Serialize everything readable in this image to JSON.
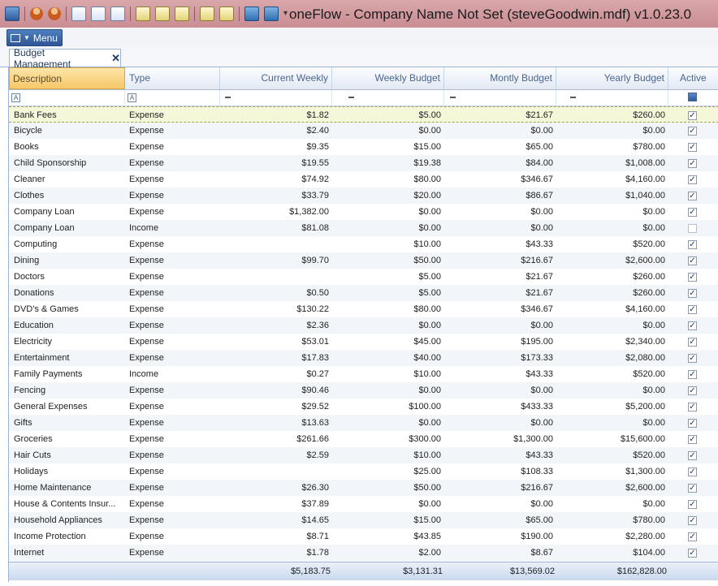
{
  "window": {
    "title": "oneFlow - Company Name Not Set (steveGoodwin.mdf) v1.0.23.0"
  },
  "quick_access_icons": [
    "database-icon",
    "users-icon",
    "report-icon",
    "report-icon",
    "report-icon",
    "report-icon",
    "report-icon",
    "report-icon",
    "notes-icon",
    "notes-icon",
    "book-icon",
    "book-icon",
    "dropdown-icon"
  ],
  "menu": {
    "label": "Menu"
  },
  "tabs": [
    {
      "label": "Budget Management",
      "close": "✕"
    }
  ],
  "grid": {
    "columns": [
      {
        "key": "description",
        "label": "Description"
      },
      {
        "key": "type",
        "label": "Type"
      },
      {
        "key": "current_weekly",
        "label": "Current Weekly"
      },
      {
        "key": "weekly_budget",
        "label": "Weekly Budget"
      },
      {
        "key": "monthly_budget",
        "label": "Montly Budget"
      },
      {
        "key": "yearly_budget",
        "label": "Yearly Budget"
      },
      {
        "key": "active",
        "label": "Active"
      }
    ],
    "rows": [
      [
        "Bank Fees",
        "Expense",
        "$1.82",
        "$5.00",
        "$21.67",
        "$260.00",
        true
      ],
      [
        "Bicycle",
        "Expense",
        "$2.40",
        "$0.00",
        "$0.00",
        "$0.00",
        true
      ],
      [
        "Books",
        "Expense",
        "$9.35",
        "$15.00",
        "$65.00",
        "$780.00",
        true
      ],
      [
        "Child Sponsorship",
        "Expense",
        "$19.55",
        "$19.38",
        "$84.00",
        "$1,008.00",
        true
      ],
      [
        "Cleaner",
        "Expense",
        "$74.92",
        "$80.00",
        "$346.67",
        "$4,160.00",
        true
      ],
      [
        "Clothes",
        "Expense",
        "$33.79",
        "$20.00",
        "$86.67",
        "$1,040.00",
        true
      ],
      [
        "Company Loan",
        "Expense",
        "$1,382.00",
        "$0.00",
        "$0.00",
        "$0.00",
        true
      ],
      [
        "Company Loan",
        "Income",
        "$81.08",
        "$0.00",
        "$0.00",
        "$0.00",
        false
      ],
      [
        "Computing",
        "Expense",
        "",
        "$10.00",
        "$43.33",
        "$520.00",
        true
      ],
      [
        "Dining",
        "Expense",
        "$99.70",
        "$50.00",
        "$216.67",
        "$2,600.00",
        true
      ],
      [
        "Doctors",
        "Expense",
        "",
        "$5.00",
        "$21.67",
        "$260.00",
        true
      ],
      [
        "Donations",
        "Expense",
        "$0.50",
        "$5.00",
        "$21.67",
        "$260.00",
        true
      ],
      [
        "DVD's & Games",
        "Expense",
        "$130.22",
        "$80.00",
        "$346.67",
        "$4,160.00",
        true
      ],
      [
        "Education",
        "Expense",
        "$2.36",
        "$0.00",
        "$0.00",
        "$0.00",
        true
      ],
      [
        "Electricity",
        "Expense",
        "$53.01",
        "$45.00",
        "$195.00",
        "$2,340.00",
        true
      ],
      [
        "Entertainment",
        "Expense",
        "$17.83",
        "$40.00",
        "$173.33",
        "$2,080.00",
        true
      ],
      [
        "Family Payments",
        "Income",
        "$0.27",
        "$10.00",
        "$43.33",
        "$520.00",
        true
      ],
      [
        "Fencing",
        "Expense",
        "$90.46",
        "$0.00",
        "$0.00",
        "$0.00",
        true
      ],
      [
        "General Expenses",
        "Expense",
        "$29.52",
        "$100.00",
        "$433.33",
        "$5,200.00",
        true
      ],
      [
        "Gifts",
        "Expense",
        "$13.63",
        "$0.00",
        "$0.00",
        "$0.00",
        true
      ],
      [
        "Groceries",
        "Expense",
        "$261.66",
        "$300.00",
        "$1,300.00",
        "$15,600.00",
        true
      ],
      [
        "Hair Cuts",
        "Expense",
        "$2.59",
        "$10.00",
        "$43.33",
        "$520.00",
        true
      ],
      [
        "Holidays",
        "Expense",
        "",
        "$25.00",
        "$108.33",
        "$1,300.00",
        true
      ],
      [
        "Home Maintenance",
        "Expense",
        "$26.30",
        "$50.00",
        "$216.67",
        "$2,600.00",
        true
      ],
      [
        "House & Contents Insur...",
        "Expense",
        "$37.89",
        "$0.00",
        "$0.00",
        "$0.00",
        true
      ],
      [
        "Household Appliances",
        "Expense",
        "$14.65",
        "$15.00",
        "$65.00",
        "$780.00",
        true
      ],
      [
        "Income Protection",
        "Expense",
        "$8.71",
        "$43.85",
        "$190.00",
        "$2,280.00",
        true
      ],
      [
        "Internet",
        "Expense",
        "$1.78",
        "$2.00",
        "$8.67",
        "$104.00",
        true
      ]
    ],
    "selected_row": 0,
    "totals": {
      "current_weekly": "$5,183.75",
      "weekly_budget": "$3,131.31",
      "monthly_budget": "$13,569.02",
      "yearly_budget": "$162,828.00"
    }
  }
}
